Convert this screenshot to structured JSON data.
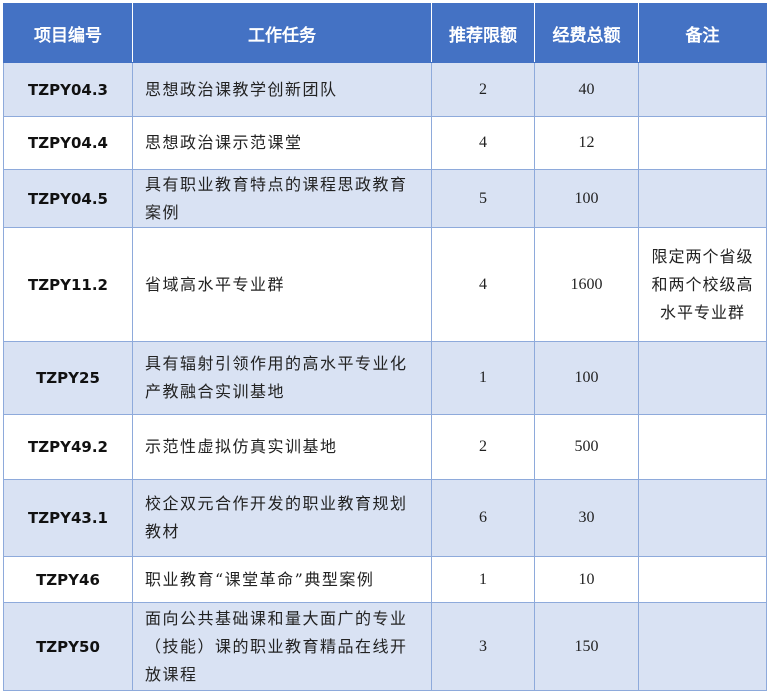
{
  "table": {
    "headers": [
      "项目编号",
      "工作任务",
      "推荐限额",
      "经费总额",
      "备注"
    ],
    "rows": [
      {
        "code": "TZPY04.3",
        "task": "思想政治课教学创新团队",
        "quota": "2",
        "funding": "40",
        "remark": ""
      },
      {
        "code": "TZPY04.4",
        "task": "思想政治课示范课堂",
        "quota": "4",
        "funding": "12",
        "remark": ""
      },
      {
        "code": "TZPY04.5",
        "task": "具有职业教育特点的课程思政教育案例",
        "quota": "5",
        "funding": "100",
        "remark": ""
      },
      {
        "code": "TZPY11.2",
        "task": "省域高水平专业群",
        "quota": "4",
        "funding": "1600",
        "remark": "限定两个省级和两个校级高水平专业群"
      },
      {
        "code": "TZPY25",
        "task": "具有辐射引领作用的高水平专业化产教融合实训基地",
        "quota": "1",
        "funding": "100",
        "remark": ""
      },
      {
        "code": "TZPY49.2",
        "task": "示范性虚拟仿真实训基地",
        "quota": "2",
        "funding": "500",
        "remark": ""
      },
      {
        "code": "TZPY43.1",
        "task": "校企双元合作开发的职业教育规划教材",
        "quota": "6",
        "funding": "30",
        "remark": ""
      },
      {
        "code": "TZPY46",
        "task": "职业教育“课堂革命”典型案例",
        "quota": "1",
        "funding": "10",
        "remark": ""
      },
      {
        "code": "TZPY50",
        "task": "面向公共基础课和量大面广的专业（技能）课的职业教育精品在线开放课程",
        "quota": "3",
        "funding": "150",
        "remark": ""
      }
    ]
  },
  "colors": {
    "header_bg": "#4472c4",
    "stripe_bg": "#d9e2f3",
    "border": "#8eaadb"
  }
}
